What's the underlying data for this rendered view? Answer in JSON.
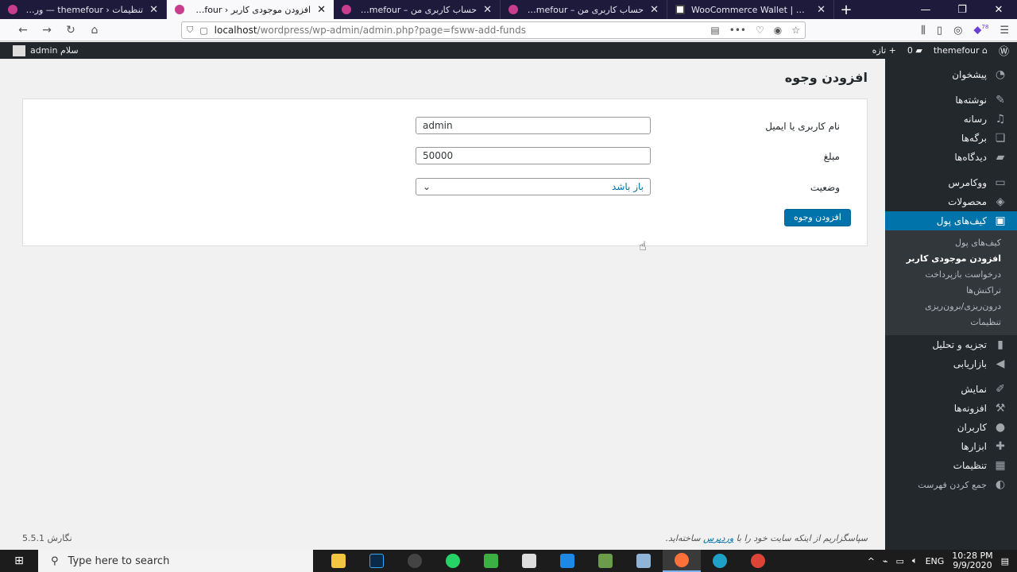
{
  "browser": {
    "tabs": [
      {
        "title": "تنظیمات ‹ themefour — وردپرس",
        "active": false
      },
      {
        "title": "افزودن موجودی کاربر ‹ themefour",
        "active": true
      },
      {
        "title": "حساب کاربری من – themefour",
        "active": false
      },
      {
        "title": "حساب کاربری من – themefour",
        "active": false
      },
      {
        "title": "WooCommerce Wallet | Doc",
        "active": false
      }
    ],
    "url_host": "localhost",
    "url_path": "/wordpress/wp-admin/admin.php?page=fsww-add-funds",
    "extension_badge": "78"
  },
  "adminbar": {
    "site_name": "themefour",
    "comments_count": "0",
    "new_label": "تازه",
    "greeting": "سلام admin"
  },
  "sidebar": {
    "items": [
      {
        "label": "پیشخوان",
        "icon": "dashboard-icon"
      },
      {
        "label": "نوشته‌ها",
        "icon": "pin-icon"
      },
      {
        "label": "رسانه",
        "icon": "media-icon"
      },
      {
        "label": "برگه‌ها",
        "icon": "pages-icon"
      },
      {
        "label": "دیدگاه‌ها",
        "icon": "comments-icon"
      },
      {
        "label": "ووکامرس",
        "icon": "woo-icon"
      },
      {
        "label": "محصولات",
        "icon": "products-icon"
      },
      {
        "label": "کیف‌های پول",
        "icon": "wallet-icon"
      },
      {
        "label": "تجزیه و تحلیل",
        "icon": "analytics-icon"
      },
      {
        "label": "بازاریابی",
        "icon": "marketing-icon"
      },
      {
        "label": "نمایش",
        "icon": "appearance-icon"
      },
      {
        "label": "افزونه‌ها",
        "icon": "plugins-icon"
      },
      {
        "label": "کاربران",
        "icon": "users-icon"
      },
      {
        "label": "ابزارها",
        "icon": "tools-icon"
      },
      {
        "label": "تنظیمات",
        "icon": "settings-icon"
      },
      {
        "label": "جمع کردن فهرست",
        "icon": "collapse-icon"
      }
    ],
    "submenu": [
      "کیف‌های پول",
      "افزودن موجودی کاربر",
      "درخواست بازپرداخت",
      "تراکنش‌ها",
      "درون‌ریزی/برون‌ریزی",
      "تنظیمات"
    ]
  },
  "page": {
    "title": "افزودن وجوه",
    "fields": {
      "user_label": "نام کاربری یا ایمیل",
      "user_value": "admin",
      "amount_label": "مبلغ",
      "amount_value": "50000",
      "status_label": "وضعیت",
      "status_value": "باز باشد"
    },
    "submit_label": "افزودن وجوه"
  },
  "footer": {
    "thanks_prefix": "سپاسگزاریم از اینکه سایت خود را با ",
    "thanks_link": "وردپرس",
    "thanks_suffix": " ساخته‌اید.",
    "version": "نگارش 5.5.1"
  },
  "taskbar": {
    "search_placeholder": "Type here to search",
    "lang": "ENG",
    "time": "10:28 PM",
    "date": "9/9/2020"
  }
}
